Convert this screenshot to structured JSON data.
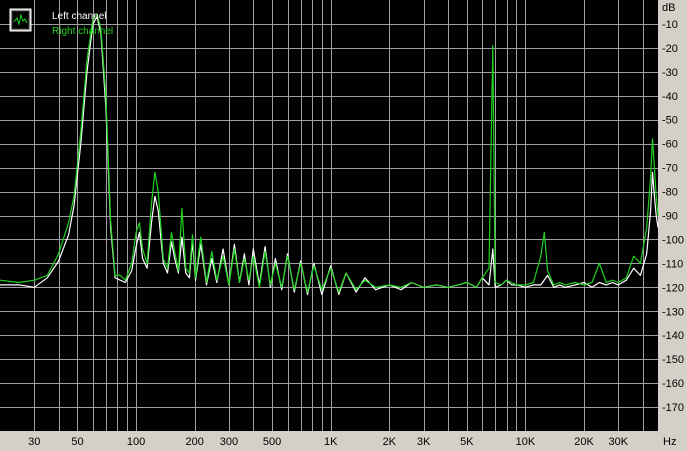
{
  "chart_data": {
    "type": "line",
    "x_scale": "log",
    "xlim": [
      20,
      48000
    ],
    "ylim": [
      -180,
      0
    ],
    "grid": true,
    "background": "#000000",
    "grid_color": "#a0a0a0",
    "legend_position": "top-left",
    "x_unit_label": "Hz",
    "y_unit_label": "dB",
    "x_ticks": [
      {
        "value": 30,
        "label": "30"
      },
      {
        "value": 50,
        "label": "50"
      },
      {
        "value": 100,
        "label": "100"
      },
      {
        "value": 200,
        "label": "200"
      },
      {
        "value": 300,
        "label": "300"
      },
      {
        "value": 500,
        "label": "500"
      },
      {
        "value": 1000,
        "label": "1K"
      },
      {
        "value": 2000,
        "label": "2K"
      },
      {
        "value": 3000,
        "label": "3K"
      },
      {
        "value": 5000,
        "label": "5K"
      },
      {
        "value": 10000,
        "label": "10K"
      },
      {
        "value": 20000,
        "label": "20K"
      },
      {
        "value": 30000,
        "label": "30K"
      }
    ],
    "y_ticks": [
      -10,
      -20,
      -30,
      -40,
      -50,
      -60,
      -70,
      -80,
      -90,
      -100,
      -110,
      -120,
      -130,
      -140,
      -150,
      -160,
      -170
    ],
    "series": [
      {
        "name": "Left channel",
        "color": "#ffffff",
        "points": [
          [
            20,
            -119
          ],
          [
            25,
            -119
          ],
          [
            30,
            -120
          ],
          [
            35,
            -116
          ],
          [
            40,
            -109
          ],
          [
            45,
            -98
          ],
          [
            48,
            -86
          ],
          [
            52,
            -60
          ],
          [
            56,
            -30
          ],
          [
            60,
            -10
          ],
          [
            63,
            -7
          ],
          [
            66,
            -14
          ],
          [
            70,
            -45
          ],
          [
            74,
            -95
          ],
          [
            78,
            -116
          ],
          [
            83,
            -117
          ],
          [
            88,
            -118
          ],
          [
            95,
            -113
          ],
          [
            100,
            -103
          ],
          [
            104,
            -97
          ],
          [
            108,
            -108
          ],
          [
            114,
            -112
          ],
          [
            120,
            -93
          ],
          [
            125,
            -82
          ],
          [
            130,
            -88
          ],
          [
            138,
            -110
          ],
          [
            145,
            -114
          ],
          [
            152,
            -101
          ],
          [
            158,
            -108
          ],
          [
            165,
            -114
          ],
          [
            172,
            -99
          ],
          [
            180,
            -114
          ],
          [
            188,
            -116
          ],
          [
            195,
            -101
          ],
          [
            202,
            -117
          ],
          [
            215,
            -102
          ],
          [
            230,
            -119
          ],
          [
            245,
            -108
          ],
          [
            260,
            -118
          ],
          [
            280,
            -104
          ],
          [
            300,
            -119
          ],
          [
            320,
            -102
          ],
          [
            340,
            -118
          ],
          [
            360,
            -106
          ],
          [
            380,
            -119
          ],
          [
            400,
            -104
          ],
          [
            430,
            -119
          ],
          [
            460,
            -103
          ],
          [
            490,
            -120
          ],
          [
            520,
            -108
          ],
          [
            560,
            -121
          ],
          [
            600,
            -106
          ],
          [
            650,
            -122
          ],
          [
            700,
            -109
          ],
          [
            760,
            -123
          ],
          [
            820,
            -110
          ],
          [
            900,
            -123
          ],
          [
            1000,
            -111
          ],
          [
            1100,
            -123
          ],
          [
            1200,
            -114
          ],
          [
            1350,
            -122
          ],
          [
            1500,
            -116
          ],
          [
            1700,
            -121
          ],
          [
            2000,
            -119
          ],
          [
            2300,
            -121
          ],
          [
            2600,
            -118
          ],
          [
            3000,
            -120
          ],
          [
            3500,
            -119
          ],
          [
            4000,
            -120
          ],
          [
            4500,
            -119
          ],
          [
            5000,
            -118
          ],
          [
            5600,
            -120
          ],
          [
            6000,
            -116
          ],
          [
            6500,
            -119
          ],
          [
            6800,
            -104
          ],
          [
            7000,
            -120
          ],
          [
            7500,
            -119
          ],
          [
            8000,
            -117
          ],
          [
            8500,
            -119
          ],
          [
            9000,
            -119
          ],
          [
            10000,
            -120
          ],
          [
            11000,
            -119
          ],
          [
            12000,
            -119
          ],
          [
            13000,
            -115
          ],
          [
            14000,
            -120
          ],
          [
            15000,
            -119
          ],
          [
            16000,
            -120
          ],
          [
            18000,
            -119
          ],
          [
            20000,
            -118
          ],
          [
            22000,
            -120
          ],
          [
            24000,
            -118
          ],
          [
            26000,
            -119
          ],
          [
            28000,
            -118
          ],
          [
            30000,
            -119
          ],
          [
            33000,
            -117
          ],
          [
            36000,
            -112
          ],
          [
            39000,
            -115
          ],
          [
            42000,
            -106
          ],
          [
            44000,
            -88
          ],
          [
            45000,
            -72
          ],
          [
            46000,
            -82
          ],
          [
            47000,
            -90
          ],
          [
            48000,
            -95
          ]
        ]
      },
      {
        "name": "Right channel",
        "color": "#1fd21f",
        "points": [
          [
            20,
            -117
          ],
          [
            25,
            -118
          ],
          [
            30,
            -117
          ],
          [
            35,
            -115
          ],
          [
            40,
            -106
          ],
          [
            45,
            -93
          ],
          [
            48,
            -82
          ],
          [
            52,
            -55
          ],
          [
            56,
            -25
          ],
          [
            60,
            -8
          ],
          [
            63,
            -6
          ],
          [
            66,
            -12
          ],
          [
            70,
            -40
          ],
          [
            74,
            -92
          ],
          [
            78,
            -115
          ],
          [
            83,
            -115
          ],
          [
            88,
            -117
          ],
          [
            95,
            -110
          ],
          [
            100,
            -97
          ],
          [
            104,
            -93
          ],
          [
            108,
            -104
          ],
          [
            114,
            -110
          ],
          [
            120,
            -85
          ],
          [
            125,
            -72
          ],
          [
            130,
            -80
          ],
          [
            138,
            -108
          ],
          [
            145,
            -112
          ],
          [
            152,
            -97
          ],
          [
            158,
            -105
          ],
          [
            165,
            -113
          ],
          [
            172,
            -87
          ],
          [
            180,
            -112
          ],
          [
            188,
            -114
          ],
          [
            195,
            -98
          ],
          [
            202,
            -116
          ],
          [
            215,
            -99
          ],
          [
            230,
            -118
          ],
          [
            245,
            -105
          ],
          [
            260,
            -117
          ],
          [
            280,
            -107
          ],
          [
            300,
            -119
          ],
          [
            320,
            -104
          ],
          [
            340,
            -118
          ],
          [
            360,
            -108
          ],
          [
            380,
            -117
          ],
          [
            400,
            -107
          ],
          [
            430,
            -120
          ],
          [
            460,
            -105
          ],
          [
            490,
            -119
          ],
          [
            520,
            -110
          ],
          [
            560,
            -120
          ],
          [
            600,
            -107
          ],
          [
            650,
            -121
          ],
          [
            700,
            -110
          ],
          [
            760,
            -122
          ],
          [
            820,
            -111
          ],
          [
            900,
            -121
          ],
          [
            1000,
            -112
          ],
          [
            1100,
            -122
          ],
          [
            1200,
            -114
          ],
          [
            1350,
            -121
          ],
          [
            1500,
            -117
          ],
          [
            1700,
            -120
          ],
          [
            2000,
            -119
          ],
          [
            2300,
            -120
          ],
          [
            2600,
            -118
          ],
          [
            3000,
            -120
          ],
          [
            3500,
            -119
          ],
          [
            4000,
            -120
          ],
          [
            4500,
            -119
          ],
          [
            5000,
            -118
          ],
          [
            5600,
            -120
          ],
          [
            6000,
            -116
          ],
          [
            6500,
            -112
          ],
          [
            6800,
            -19
          ],
          [
            7000,
            -118
          ],
          [
            7500,
            -119
          ],
          [
            8000,
            -117
          ],
          [
            8500,
            -118
          ],
          [
            9000,
            -119
          ],
          [
            10000,
            -119
          ],
          [
            11000,
            -118
          ],
          [
            12000,
            -107
          ],
          [
            12500,
            -97
          ],
          [
            13000,
            -113
          ],
          [
            14000,
            -119
          ],
          [
            15000,
            -118
          ],
          [
            16000,
            -119
          ],
          [
            18000,
            -118
          ],
          [
            20000,
            -119
          ],
          [
            22000,
            -118
          ],
          [
            24000,
            -110
          ],
          [
            26000,
            -118
          ],
          [
            28000,
            -117
          ],
          [
            30000,
            -118
          ],
          [
            33000,
            -116
          ],
          [
            36000,
            -107
          ],
          [
            39000,
            -110
          ],
          [
            42000,
            -95
          ],
          [
            44000,
            -74
          ],
          [
            45000,
            -58
          ],
          [
            46000,
            -70
          ],
          [
            47000,
            -82
          ],
          [
            48000,
            -90
          ]
        ]
      }
    ]
  }
}
